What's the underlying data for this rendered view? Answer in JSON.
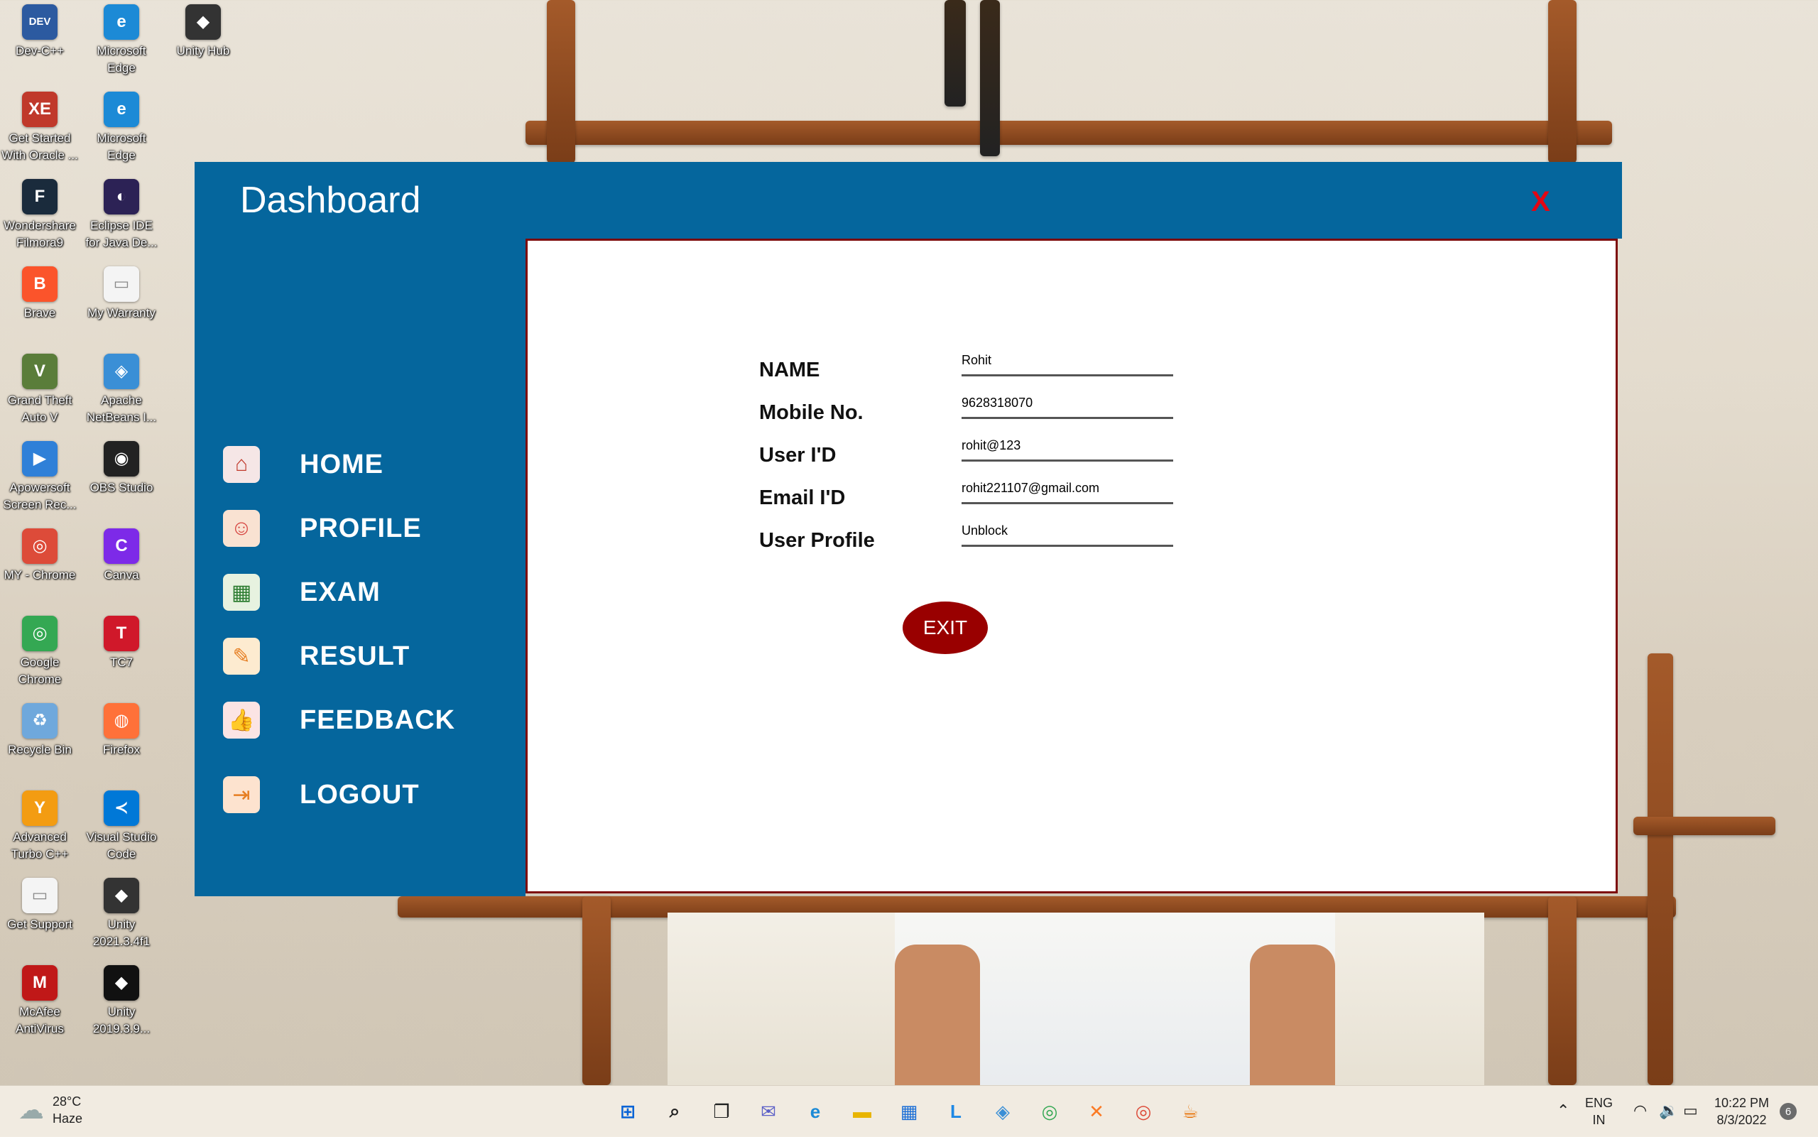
{
  "desktop": {
    "icons": [
      {
        "label": "Dev-C++",
        "glyph": "DEV",
        "color": "#2c5aa0",
        "icon": "devcpp-icon"
      },
      {
        "label": "Microsoft Edge",
        "glyph": "e",
        "color": "#1c8ad6",
        "icon": "edge-icon"
      },
      {
        "label": "Unity Hub",
        "glyph": "◆",
        "color": "#333333",
        "icon": "unity-hub-icon"
      },
      {
        "label": "Get Started With Oracle ...",
        "glyph": "XE",
        "color": "#c0392b",
        "icon": "oracle-icon"
      },
      {
        "label": "Microsoft Edge",
        "glyph": "e",
        "color": "#1c8ad6",
        "icon": "edge-icon"
      },
      {
        "label": "Wondershare Filmora9",
        "glyph": "F",
        "color": "#1a2b3c",
        "icon": "filmora-icon"
      },
      {
        "label": "Eclipse IDE for Java De...",
        "glyph": "◐",
        "color": "#2c2255",
        "icon": "eclipse-icon"
      },
      {
        "label": "Brave",
        "glyph": "B",
        "color": "#fb542b",
        "icon": "brave-icon"
      },
      {
        "label": "My Warranty",
        "glyph": "▭",
        "color": "#f4f4f4",
        "icon": "file-icon"
      },
      {
        "label": "Grand Theft Auto V",
        "glyph": "V",
        "color": "#5a7d3a",
        "icon": "gta-icon"
      },
      {
        "label": "Apache NetBeans I...",
        "glyph": "◈",
        "color": "#3a8fd6",
        "icon": "netbeans-icon"
      },
      {
        "label": "Apowersoft Screen Rec...",
        "glyph": "▶",
        "color": "#2f80d8",
        "icon": "apowersoft-icon"
      },
      {
        "label": "OBS Studio",
        "glyph": "◉",
        "color": "#222222",
        "icon": "obs-icon"
      },
      {
        "label": "MY - Chrome",
        "glyph": "◎",
        "color": "#dd4b39",
        "icon": "chrome-profile-icon"
      },
      {
        "label": "Canva",
        "glyph": "C",
        "color": "#7d2ae8",
        "icon": "canva-icon"
      },
      {
        "label": "Google Chrome",
        "glyph": "◎",
        "color": "#34a853",
        "icon": "chrome-icon"
      },
      {
        "label": "TC7",
        "glyph": "T",
        "color": "#d0182a",
        "icon": "tc7-icon"
      },
      {
        "label": "Recycle Bin",
        "glyph": "♻",
        "color": "#6fa8dc",
        "icon": "recycle-bin-icon"
      },
      {
        "label": "Firefox",
        "glyph": "◍",
        "color": "#ff7139",
        "icon": "firefox-icon"
      },
      {
        "label": "Advanced Turbo C++",
        "glyph": "Y",
        "color": "#f39c12",
        "icon": "turbo-cpp-icon"
      },
      {
        "label": "Visual Studio Code",
        "glyph": "≺",
        "color": "#0078d7",
        "icon": "vscode-icon"
      },
      {
        "label": "Get Support",
        "glyph": "▭",
        "color": "#f4f4f4",
        "icon": "file-icon"
      },
      {
        "label": "Unity 2021.3.4f1",
        "glyph": "◆",
        "color": "#333333",
        "icon": "unity-icon"
      },
      {
        "label": "McAfee AntiVirus",
        "glyph": "M",
        "color": "#c01818",
        "icon": "mcafee-icon"
      },
      {
        "label": "Unity 2019.3.9...",
        "glyph": "◆",
        "color": "#111111",
        "icon": "unity-icon"
      }
    ]
  },
  "window": {
    "title": "Dashboard",
    "close_label": "X"
  },
  "nav": [
    {
      "label": "HOME",
      "icon": "home-icon",
      "glyph": "⌂",
      "bg": "#f5e6e6",
      "fg": "#c0392b"
    },
    {
      "label": "PROFILE",
      "icon": "user-icon",
      "glyph": "☺",
      "bg": "#f9e2d2",
      "fg": "#d64541"
    },
    {
      "label": "EXAM",
      "icon": "exam-icon",
      "glyph": "▦",
      "bg": "#e7f2e0",
      "fg": "#2e7d32"
    },
    {
      "label": "RESULT",
      "icon": "result-icon",
      "glyph": "✎",
      "bg": "#fdebd0",
      "fg": "#e67e22"
    },
    {
      "label": "FEEDBACK",
      "icon": "feedback-icon",
      "glyph": "👍",
      "bg": "#fbe4e4",
      "fg": "#c0392b"
    },
    {
      "label": "LOGOUT",
      "icon": "logout-icon",
      "glyph": "⇥",
      "bg": "#fde3cf",
      "fg": "#e67e22"
    }
  ],
  "profile": {
    "fields": [
      {
        "label": "NAME",
        "value": "Rohit"
      },
      {
        "label": "Mobile No.",
        "value": "9628318070"
      },
      {
        "label": "User I'D",
        "value": "rohit@123"
      },
      {
        "label": "Email I'D",
        "value": "rohit221107@gmail.com"
      },
      {
        "label": "User Profile",
        "value": "Unblock"
      }
    ],
    "exit_label": "EXIT"
  },
  "taskbar": {
    "weather_temp": "28°C",
    "weather_desc": "Haze",
    "apps": [
      {
        "icon": "start-icon",
        "glyph": "⊞",
        "color": "#0a64d6"
      },
      {
        "icon": "search-icon",
        "glyph": "⌕",
        "color": "#222222"
      },
      {
        "icon": "task-view-icon",
        "glyph": "❐",
        "color": "#222222"
      },
      {
        "icon": "chat-icon",
        "glyph": "✉",
        "color": "#5b5fc7"
      },
      {
        "icon": "edge-icon",
        "glyph": "e",
        "color": "#1c8ad6"
      },
      {
        "icon": "file-explorer-icon",
        "glyph": "▬",
        "color": "#e8b400"
      },
      {
        "icon": "store-icon",
        "glyph": "▦",
        "color": "#1c6fd6"
      },
      {
        "icon": "launcher-l-icon",
        "glyph": "L",
        "color": "#1e88e5"
      },
      {
        "icon": "netbeans-icon",
        "glyph": "◈",
        "color": "#3a8fd6"
      },
      {
        "icon": "chrome-icon",
        "glyph": "◎",
        "color": "#34a853"
      },
      {
        "icon": "xampp-icon",
        "glyph": "✕",
        "color": "#fb7a24"
      },
      {
        "icon": "chrome-profile-icon",
        "glyph": "◎",
        "color": "#dd4b39"
      },
      {
        "icon": "java-icon",
        "glyph": "☕",
        "color": "#e76f00"
      }
    ],
    "lang_top": "ENG",
    "lang_bottom": "IN",
    "time": "10:22 PM",
    "date": "8/3/2022",
    "notifications": "6"
  }
}
